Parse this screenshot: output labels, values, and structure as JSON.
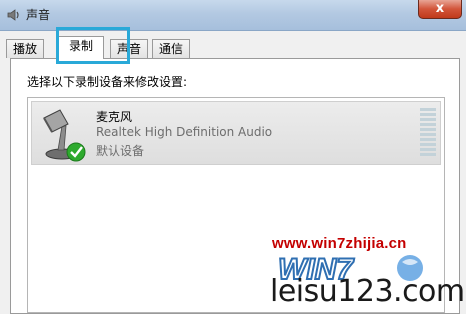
{
  "window": {
    "title": "声音",
    "close_label": "x"
  },
  "tabs": [
    {
      "label": "播放",
      "active": false
    },
    {
      "label": "录制",
      "active": true
    },
    {
      "label": "声音",
      "active": false
    },
    {
      "label": "通信",
      "active": false
    }
  ],
  "panel": {
    "instruction": "选择以下录制设备来修改设置:"
  },
  "devices": [
    {
      "name": "麦克风",
      "description": "Realtek High Definition Audio",
      "status": "默认设备",
      "icon": "microphone-icon",
      "default_badge_icon": "check-icon"
    }
  ],
  "watermark": {
    "url": "www.win7zhijia.cn",
    "logo_text": "WIN7",
    "site": "leisu123.com"
  },
  "colors": {
    "highlight": "#29a9d8",
    "watermark_red": "#c40000",
    "check_green": "#2eaa2e"
  }
}
